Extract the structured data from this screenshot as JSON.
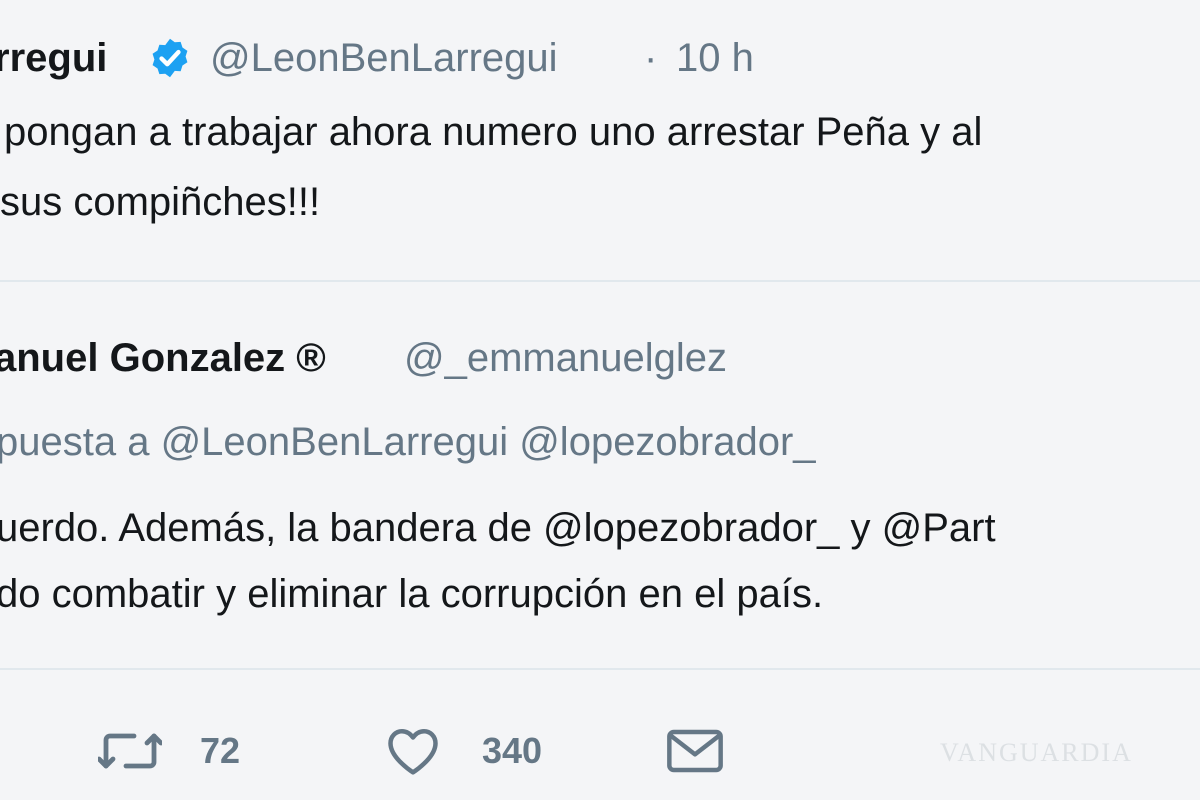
{
  "tweet": {
    "author_name": "rregui",
    "author_handle": "@LeonBenLarregui",
    "separator": "·",
    "time": "10 h",
    "verified": true,
    "text_line1": "pongan a trabajar ahora numero uno arrestar Peña y al",
    "text_line2": "sus compiñches!!!"
  },
  "quoted": {
    "author_name": "anuel Gonzalez ®",
    "author_handle": "@_emmanuelglez",
    "reply_line": "puesta a @LeonBenLarregui @lopezobrador_",
    "text_line1": "uerdo. Además, la bandera de @lopezobrador_ y @Part",
    "text_line2": "do combatir y eliminar la corrupción en el país."
  },
  "actions": {
    "retweet_icon": "retweet-icon",
    "retweet_count": "72",
    "like_icon": "heart-icon",
    "like_count": "340",
    "message_icon": "envelope-icon"
  },
  "watermark": "VANGUARDIA",
  "colors": {
    "background": "#f4f5f7",
    "text": "#14171a",
    "secondary": "#657786",
    "verified": "#1da1f2",
    "divider": "#e1e8ed"
  }
}
